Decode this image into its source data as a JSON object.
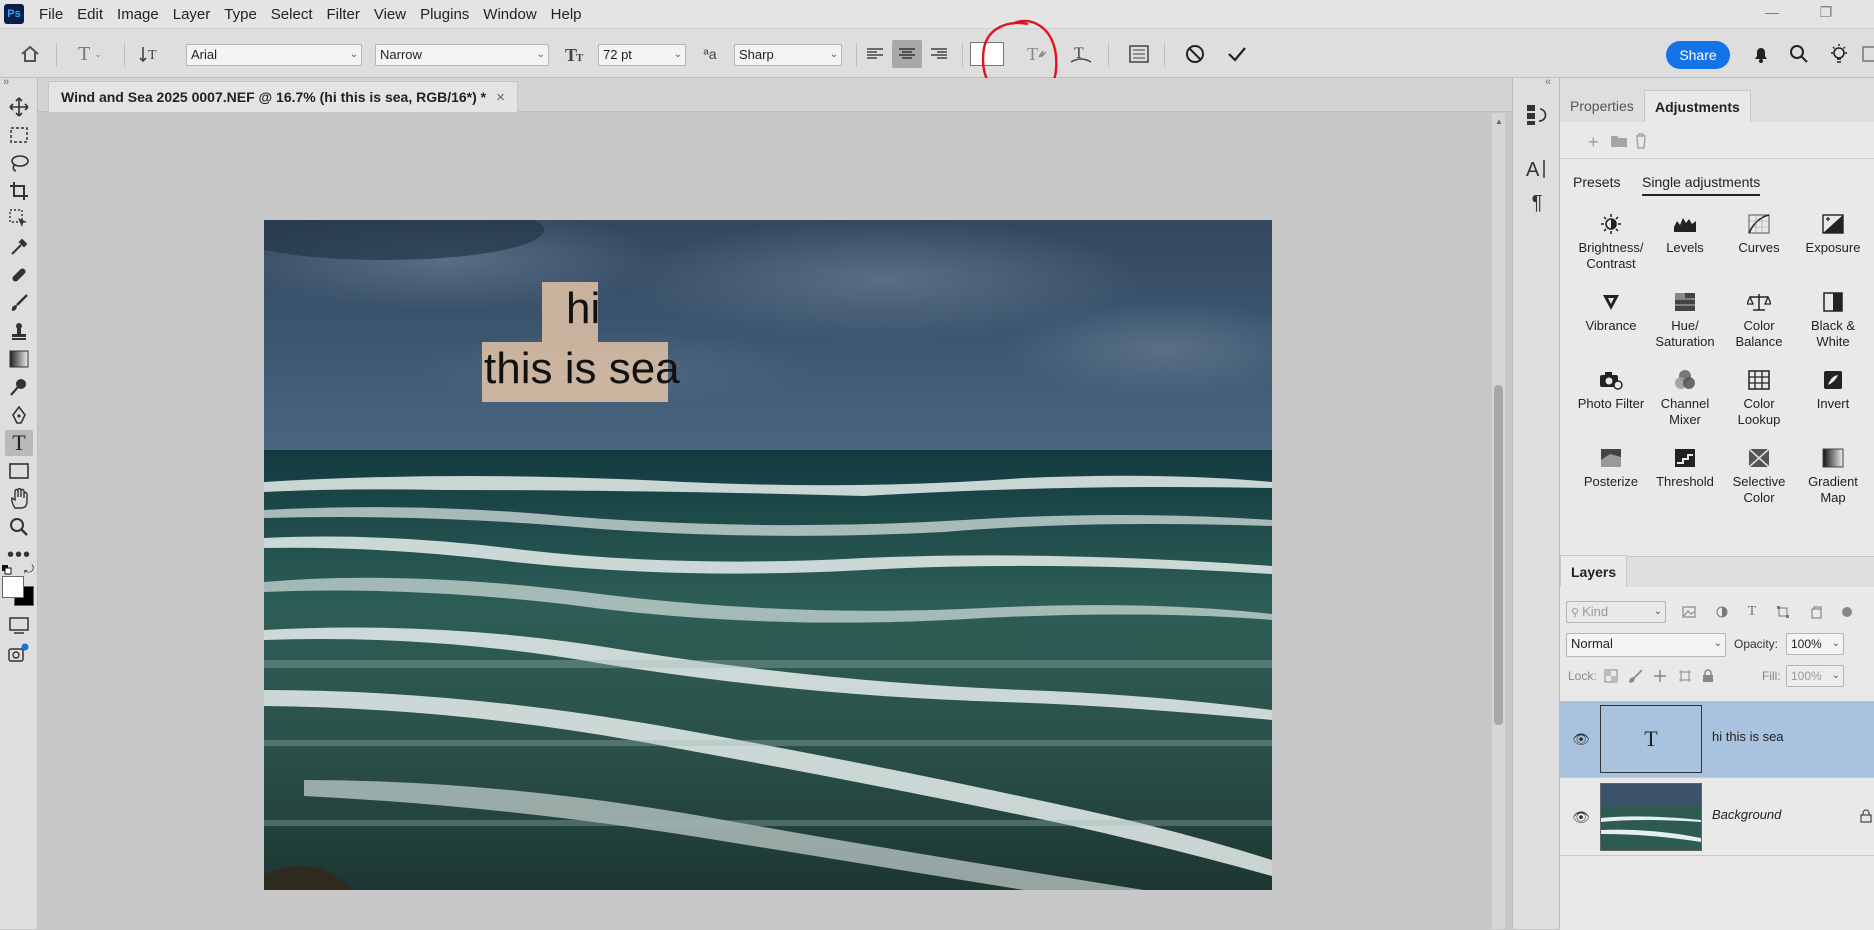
{
  "app": {
    "logo": "Ps"
  },
  "menu": [
    "File",
    "Edit",
    "Image",
    "Layer",
    "Type",
    "Select",
    "Filter",
    "View",
    "Plugins",
    "Window",
    "Help"
  ],
  "options": {
    "font_family": "Arial",
    "font_style": "Narrow",
    "font_size": "72 pt",
    "antialias_icon_text": "ªa",
    "antialias": "Sharp",
    "share": "Share"
  },
  "document": {
    "tab_title": "Wind and Sea 2025 0007.NEF @ 16.7% (hi  this is sea, RGB/16*) *",
    "close": "×",
    "text_line1": "hi",
    "text_line2": "this is sea"
  },
  "panel": {
    "tabs": [
      "Properties",
      "Adjustments"
    ],
    "subtabs": [
      "Presets",
      "Single adjustments"
    ],
    "adjustments": [
      {
        "label": "Brightness/\nContrast",
        "l1": "Brightness/",
        "l2": "Contrast"
      },
      {
        "l1": "Levels",
        "l2": ""
      },
      {
        "l1": "Curves",
        "l2": ""
      },
      {
        "l1": "Exposure",
        "l2": ""
      },
      {
        "l1": "Vibrance",
        "l2": ""
      },
      {
        "l1": "Hue/",
        "l2": "Saturation"
      },
      {
        "l1": "Color",
        "l2": "Balance"
      },
      {
        "l1": "Black &",
        "l2": "White"
      },
      {
        "l1": "Photo Filter",
        "l2": ""
      },
      {
        "l1": "Channel",
        "l2": "Mixer"
      },
      {
        "l1": "Color",
        "l2": "Lookup"
      },
      {
        "l1": "Invert",
        "l2": ""
      },
      {
        "l1": "Posterize",
        "l2": ""
      },
      {
        "l1": "Threshold",
        "l2": ""
      },
      {
        "l1": "Selective",
        "l2": "Color"
      },
      {
        "l1": "Gradient",
        "l2": "Map"
      }
    ]
  },
  "layers": {
    "title": "Layers",
    "kind_placeholder": "Kind",
    "blend_mode": "Normal",
    "opacity_label": "Opacity:",
    "opacity": "100%",
    "lock_label": "Lock:",
    "fill_label": "Fill:",
    "fill": "100%",
    "items": [
      {
        "name": "hi  this is sea",
        "type": "text",
        "thumb_glyph": "T"
      },
      {
        "name": "Background",
        "type": "image"
      }
    ]
  },
  "colors": {
    "accent": "#1473e6",
    "selected_layer": "#a9c3de",
    "annotation": "#e0141e"
  }
}
